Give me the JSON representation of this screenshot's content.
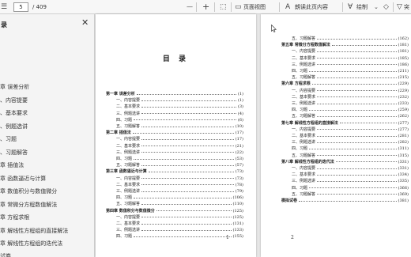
{
  "toolbar": {
    "page_current": "5",
    "page_total": "/ 409",
    "zoom_out_label": "—",
    "zoom_in_label": "+",
    "page_view_label": "页面视图",
    "read_aloud_label": "朗读此页内容",
    "draw_label": "绘制",
    "highlight_label": "突"
  },
  "sidebar": {
    "title": "录",
    "items": [
      "章 误差分析",
      "、内容提要",
      "、基本要求",
      "、例题选讲",
      "、习题",
      "、习题解答",
      "章 插值法",
      "章 函数逼近与计算",
      "章 数值积分与数值微分",
      "章 常微分方程数值解法",
      "章 方程求根",
      "章 解线性方程组的直接解法",
      "章 解线性方程组的迭代法",
      "试卷"
    ]
  },
  "page1": {
    "title": "目  录",
    "entries": [
      {
        "text": "第一章  误差分析",
        "page": "(1)",
        "bold": true
      },
      {
        "text": "一、内容提要",
        "page": "(1)",
        "bold": false
      },
      {
        "text": "二、基本要求",
        "page": "(3)",
        "bold": false
      },
      {
        "text": "三、例题选讲",
        "page": "(4)",
        "bold": false
      },
      {
        "text": "四、习题",
        "page": "(6)",
        "bold": false
      },
      {
        "text": "五、习题解答",
        "page": "(10)",
        "bold": false
      },
      {
        "text": "第二章  插值法",
        "page": "(17)",
        "bold": true
      },
      {
        "text": "一、内容提要",
        "page": "(17)",
        "bold": false
      },
      {
        "text": "二、基本要求",
        "page": "(21)",
        "bold": false
      },
      {
        "text": "三、例题选讲",
        "page": "(22)",
        "bold": false
      },
      {
        "text": "四、习题",
        "page": "(53)",
        "bold": false
      },
      {
        "text": "五、习题解答",
        "page": "(57)",
        "bold": false
      },
      {
        "text": "第三章  函数逼近与计算",
        "page": "(73)",
        "bold": true
      },
      {
        "text": "一、内容提要",
        "page": "(73)",
        "bold": false
      },
      {
        "text": "二、基本要求",
        "page": "(78)",
        "bold": false
      },
      {
        "text": "三、例题选讲",
        "page": "(79)",
        "bold": false
      },
      {
        "text": "四、习题",
        "page": "(106)",
        "bold": false
      },
      {
        "text": "五、习题解答",
        "page": "(110)",
        "bold": false
      },
      {
        "text": "第四章  数值积分与数值微分",
        "page": "(125)",
        "bold": true
      },
      {
        "text": "一、内容提要",
        "page": "(125)",
        "bold": false
      },
      {
        "text": "二、基本要求",
        "page": "(131)",
        "bold": false
      },
      {
        "text": "三、例题选讲",
        "page": "(133)",
        "bold": false
      },
      {
        "text": "四、习题",
        "page": "(155)",
        "bold": false
      }
    ],
    "page_number": "1"
  },
  "page2": {
    "entries": [
      {
        "text": "五、习题解答",
        "page": "(162)",
        "bold": false
      },
      {
        "text": "第五章  常微分方程数值解法",
        "page": "(181)",
        "bold": true
      },
      {
        "text": "一、内容提要",
        "page": "(181)",
        "bold": false
      },
      {
        "text": "二、基本要求",
        "page": "(185)",
        "bold": false
      },
      {
        "text": "三、例题选讲",
        "page": "(186)",
        "bold": false
      },
      {
        "text": "四、习题",
        "page": "(211)",
        "bold": false
      },
      {
        "text": "五、习题解答",
        "page": "(215)",
        "bold": false
      },
      {
        "text": "第六章  方程求根",
        "page": "(229)",
        "bold": true
      },
      {
        "text": "一、内容提要",
        "page": "(229)",
        "bold": false
      },
      {
        "text": "二、基本要求",
        "page": "(232)",
        "bold": false
      },
      {
        "text": "三、例题选讲",
        "page": "(233)",
        "bold": false
      },
      {
        "text": "四、习题",
        "page": "(259)",
        "bold": false
      },
      {
        "text": "五、习题解答",
        "page": "(262)",
        "bold": false
      },
      {
        "text": "第七章  解线性方程组的直接解法",
        "page": "(277)",
        "bold": true
      },
      {
        "text": "一、内容提要",
        "page": "(277)",
        "bold": false
      },
      {
        "text": "二、基本要求",
        "page": "(281)",
        "bold": false
      },
      {
        "text": "三、例题选讲",
        "page": "(282)",
        "bold": false
      },
      {
        "text": "四、习题",
        "page": "(311)",
        "bold": false
      },
      {
        "text": "五、习题解答",
        "page": "(315)",
        "bold": false
      },
      {
        "text": "第八章  解线性方程组的迭代法",
        "page": "(331)",
        "bold": true
      },
      {
        "text": "一、内容提要",
        "page": "(331)",
        "bold": false
      },
      {
        "text": "二、基本要求",
        "page": "(334)",
        "bold": false
      },
      {
        "text": "三、例题选讲",
        "page": "(335)",
        "bold": false
      },
      {
        "text": "四、习题",
        "page": "(366)",
        "bold": false
      },
      {
        "text": "五、习题解答",
        "page": "(369)",
        "bold": false
      },
      {
        "text": "模拟试卷",
        "page": "(381)",
        "bold": true
      }
    ],
    "page_number": "2"
  }
}
